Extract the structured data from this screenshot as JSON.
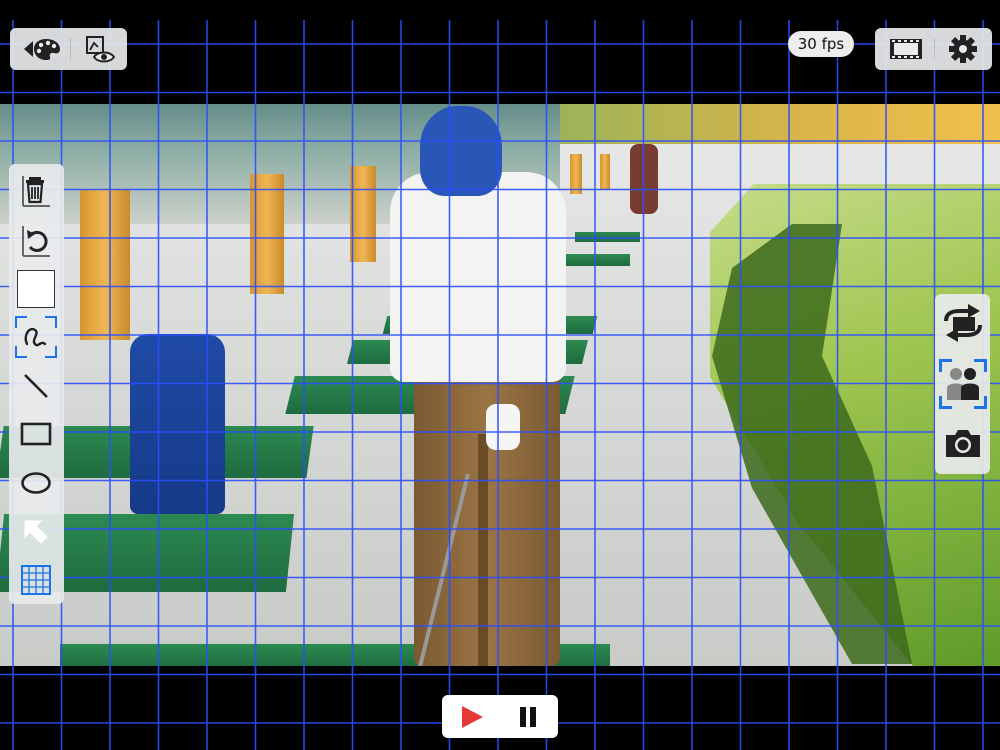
{
  "header": {
    "fps_label": "30 fps"
  },
  "top_left_toolbar": {
    "buttons": [
      {
        "name": "back-palette",
        "icon": "back-palette-icon"
      },
      {
        "name": "overlay-view",
        "icon": "overlay-eye-icon"
      }
    ]
  },
  "top_right_toolbar": {
    "buttons": [
      {
        "name": "film",
        "icon": "film-strip-icon"
      },
      {
        "name": "settings",
        "icon": "gear-icon"
      }
    ]
  },
  "draw_tools": {
    "items": [
      {
        "name": "delete",
        "icon": "trash-icon"
      },
      {
        "name": "undo",
        "icon": "undo-icon"
      },
      {
        "name": "color",
        "icon": "color-swatch-icon",
        "color": "#ffffff"
      },
      {
        "name": "freehand",
        "icon": "freehand-icon",
        "selected": true
      },
      {
        "name": "line",
        "icon": "line-icon"
      },
      {
        "name": "rectangle",
        "icon": "rectangle-icon"
      },
      {
        "name": "ellipse",
        "icon": "ellipse-icon"
      },
      {
        "name": "arrow",
        "icon": "arrow-icon"
      },
      {
        "name": "grid",
        "icon": "grid-icon",
        "active": true
      }
    ]
  },
  "right_tools": {
    "items": [
      {
        "name": "swap",
        "icon": "swap-icon"
      },
      {
        "name": "compare",
        "icon": "compare-people-icon",
        "selected": true
      },
      {
        "name": "snapshot",
        "icon": "camera-icon"
      }
    ]
  },
  "playback": {
    "buttons": [
      {
        "name": "play",
        "icon": "play-icon"
      },
      {
        "name": "pause",
        "icon": "pause-icon"
      }
    ]
  },
  "colors": {
    "accent": "#1a73e8",
    "grid": "#2a4fff",
    "play": "#e53935"
  }
}
